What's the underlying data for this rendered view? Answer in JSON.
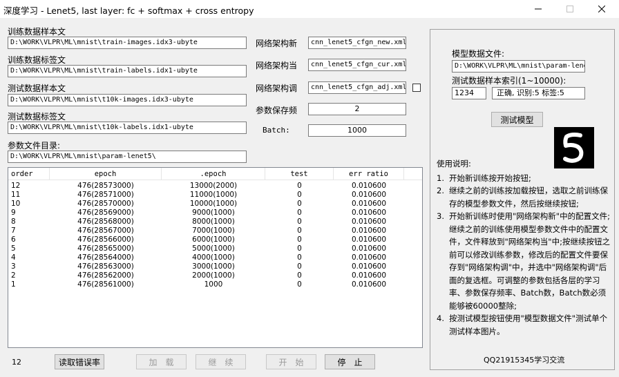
{
  "window": {
    "title": "深度学习 - Lenet5, last layer: fc + softmax + cross entropy",
    "min_icon": "minimize-icon",
    "max_icon": "maximize-icon",
    "close_icon": "close-icon"
  },
  "files": {
    "train_images_label": "训练数据样本文",
    "train_images_value": "D:\\WORK\\VLPR\\ML\\mnist\\train-images.idx3-ubyte",
    "train_labels_label": "训练数据标签文",
    "train_labels_value": "D:\\WORK\\VLPR\\ML\\mnist\\train-labels.idx1-ubyte",
    "test_images_label": "测试数据样本文",
    "test_images_value": "D:\\WORK\\VLPR\\ML\\mnist\\t10k-images.idx3-ubyte",
    "test_labels_label": "测试数据标签文",
    "test_labels_value": "D:\\WORK\\VLPR\\ML\\mnist\\t10k-labels.idx1-ubyte",
    "param_dir_label": "参数文件目录:",
    "param_dir_value": "D:\\WORK\\VLPR\\ML\\mnist\\param-lenet5\\"
  },
  "config": {
    "net_new_label": "网络架构新",
    "net_new_value": "cnn_lenet5_cfgn_new.xml",
    "net_cur_label": "网络架构当",
    "net_cur_value": "cnn_lenet5_cfgn_cur.xml",
    "net_adj_label": "网络架构调",
    "net_adj_value": "cnn_lenet5_cfgn_adj.xml",
    "save_freq_label": "参数保存频",
    "save_freq_value": "2",
    "batch_label": "Batch:",
    "batch_value": "1000"
  },
  "table": {
    "headers": [
      "order",
      "epoch",
      ".epoch",
      "test",
      "err ratio"
    ],
    "rows": [
      [
        "12",
        "476(28573000)",
        "13000(2000)",
        "0",
        "0.010600"
      ],
      [
        "11",
        "476(28571000)",
        "11000(1000)",
        "0",
        "0.010600"
      ],
      [
        "10",
        "476(28570000)",
        "10000(1000)",
        "0",
        "0.010600"
      ],
      [
        "9",
        "476(28569000)",
        "9000(1000)",
        "0",
        "0.010600"
      ],
      [
        "8",
        "476(28568000)",
        "8000(1000)",
        "0",
        "0.010600"
      ],
      [
        "7",
        "476(28567000)",
        "7000(1000)",
        "0",
        "0.010600"
      ],
      [
        "6",
        "476(28566000)",
        "6000(1000)",
        "0",
        "0.010600"
      ],
      [
        "5",
        "476(28565000)",
        "5000(1000)",
        "0",
        "0.010600"
      ],
      [
        "4",
        "476(28564000)",
        "4000(1000)",
        "0",
        "0.010600"
      ],
      [
        "3",
        "476(28563000)",
        "3000(1000)",
        "0",
        "0.010600"
      ],
      [
        "2",
        "476(28562000)",
        "2000(1000)",
        "0",
        "0.010600"
      ],
      [
        "1",
        "476(28561000)",
        "1000",
        "0",
        "0.010600"
      ]
    ]
  },
  "bottom": {
    "count": "12",
    "read_err_button": "读取错误率",
    "load_button": "加　载",
    "continue_button": "继　续",
    "start_button": "开　始",
    "stop_button": "停　止"
  },
  "model": {
    "model_file_label": "模型数据文件:",
    "model_file_value": "D:\\WORK\\VLPR\\ML\\mnist\\param-lenet",
    "sample_index_label": "测试数据样本索引(1~10000):",
    "sample_index_value": "1234",
    "result_value": "正确, 识别:5 标签:5",
    "test_button": "测试模型",
    "digit_image_name": "digit-5-image"
  },
  "instructions": {
    "title": "使用说明:",
    "items": [
      {
        "num": "1.",
        "text": "开始新训练按开始按钮;"
      },
      {
        "num": "2.",
        "text": "继续之前的训练按加载按钮，选取之前训练保存的模型参数文件，然后按继续按钮;"
      },
      {
        "num": "3.",
        "text": "开始新训练时使用\"网络架构新\"中的配置文件;继续之前的训练使用模型参数文件中的配置文件，文件释放到\"网络架构当\"中;按继续按钮之前可以修改训练参数，修改后的配置文件要保存到\"网络架构调\"中，并选中\"网络架构调\"后面的复选框。可调整的参数包括各层的学习率、参数保存频率、Batch数，Batch数必须能够被60000整除;"
      },
      {
        "num": "4.",
        "text": "按测试模型按钮使用\"模型数据文件\"测试单个测试样本图片。"
      }
    ],
    "footer": "QQ21915345学习交流"
  }
}
